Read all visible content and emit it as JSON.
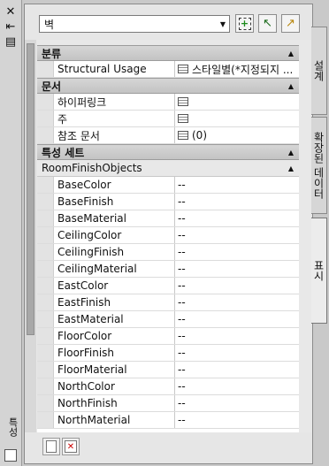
{
  "left_strip": {
    "close_glyph": "✕",
    "autohide_glyph": "⇤",
    "properties_glyph": "▤",
    "vertical_title": "특성"
  },
  "combo": {
    "value": "벽",
    "arrow": "▼"
  },
  "toolbar": {
    "quick_select": "+",
    "pick": "↖",
    "toggle_pickadd": "↗"
  },
  "sections": {
    "classification": {
      "title": "분류",
      "caret": "▲",
      "rows": [
        {
          "key": "Structural Usage",
          "value": "스타일별(*지정되지 ..."
        }
      ]
    },
    "documents": {
      "title": "문서",
      "caret": "▲",
      "rows": [
        {
          "key": "하이퍼링크",
          "value": ""
        },
        {
          "key": "주",
          "value": ""
        },
        {
          "key": "참조 문서",
          "value": "(0)"
        }
      ]
    },
    "property_sets": {
      "title": "특성 세트",
      "caret": "▲",
      "subsection": {
        "title": "RoomFinishObjects",
        "caret": "▲"
      },
      "rows": [
        {
          "key": "BaseColor",
          "value": "--"
        },
        {
          "key": "BaseFinish",
          "value": "--"
        },
        {
          "key": "BaseMaterial",
          "value": "--"
        },
        {
          "key": "CeilingColor",
          "value": "--"
        },
        {
          "key": "CeilingFinish",
          "value": "--"
        },
        {
          "key": "CeilingMaterial",
          "value": "--"
        },
        {
          "key": "EastColor",
          "value": "--"
        },
        {
          "key": "EastFinish",
          "value": "--"
        },
        {
          "key": "EastMaterial",
          "value": "--"
        },
        {
          "key": "FloorColor",
          "value": "--"
        },
        {
          "key": "FloorFinish",
          "value": "--"
        },
        {
          "key": "FloorMaterial",
          "value": "--"
        },
        {
          "key": "NorthColor",
          "value": "--"
        },
        {
          "key": "NorthFinish",
          "value": "--"
        },
        {
          "key": "NorthMaterial",
          "value": "--"
        }
      ]
    }
  },
  "tabs": [
    {
      "label": "설계"
    },
    {
      "label": "확장된 데이터"
    },
    {
      "label": "표시"
    }
  ]
}
